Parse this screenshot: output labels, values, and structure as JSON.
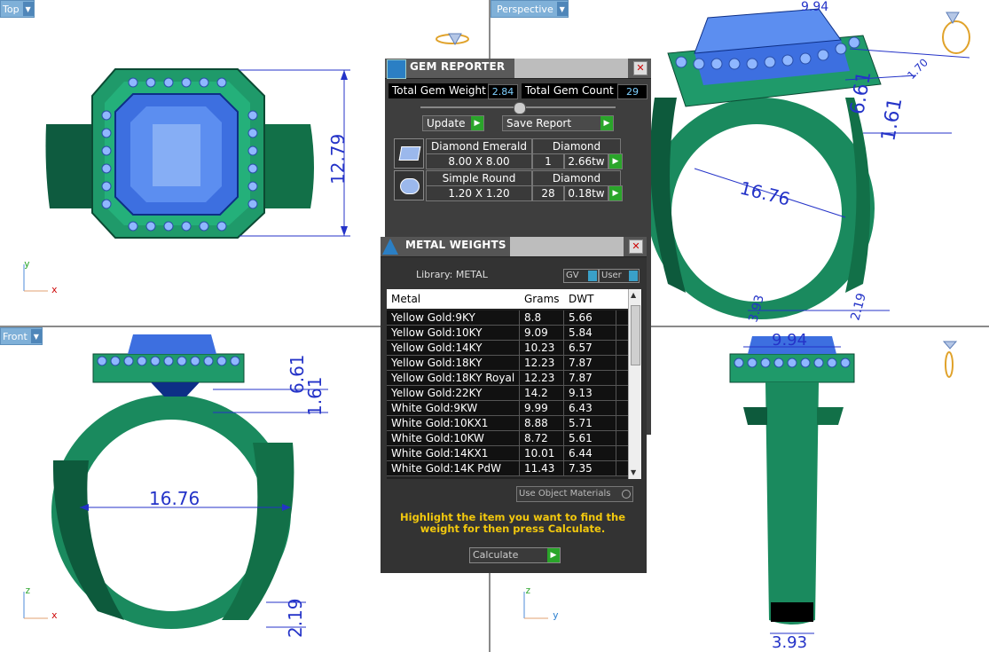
{
  "viewports": {
    "top": {
      "label": "Top",
      "dimension": "12.79",
      "axis_v": "y",
      "axis_h": "x"
    },
    "perspective": {
      "label": "Perspective",
      "dims": [
        "9.94",
        "6.61",
        "1.61",
        "16.76",
        "1.70",
        "3.93",
        "2.19"
      ]
    },
    "front": {
      "label": "Front",
      "dims": [
        "6.61",
        "1.61",
        "16.76",
        "2.19"
      ],
      "axis_v": "z",
      "axis_h": "x"
    },
    "right": {
      "dims": [
        "9.94",
        "3.93"
      ],
      "axis_v": "z",
      "axis_h": "y"
    }
  },
  "gem_reporter": {
    "title": "GEM REPORTER",
    "total_weight_label": "Total Gem Weight",
    "total_weight": "2.84",
    "total_count_label": "Total Gem Count",
    "total_count": "29",
    "update_label": "Update",
    "save_label": "Save Report",
    "gems": [
      {
        "name": "Diamond Emerald",
        "size": "8.00 X 8.00",
        "material": "Diamond",
        "count": "1",
        "weight": "2.66tw"
      },
      {
        "name": "Simple Round",
        "size": "1.20 X 1.20",
        "material": "Diamond",
        "count": "28",
        "weight": "0.18tw"
      }
    ]
  },
  "metal_weights": {
    "title": "METAL WEIGHTS",
    "library_label": "Library: METAL",
    "gv_label": "GV",
    "user_label": "User",
    "columns": [
      "Metal",
      "Grams",
      "DWT"
    ],
    "rows": [
      [
        "Yellow Gold:9KY",
        "8.8",
        "5.66"
      ],
      [
        "Yellow Gold:10KY",
        "9.09",
        "5.84"
      ],
      [
        "Yellow Gold:14KY",
        "10.23",
        "6.57"
      ],
      [
        "Yellow Gold:18KY",
        "12.23",
        "7.87"
      ],
      [
        "Yellow Gold:18KY Royal",
        "12.23",
        "7.87"
      ],
      [
        "Yellow Gold:22KY",
        "14.2",
        "9.13"
      ],
      [
        "White Gold:9KW",
        "9.99",
        "6.43"
      ],
      [
        "White Gold:10KX1",
        "8.88",
        "5.71"
      ],
      [
        "White Gold:10KW",
        "8.72",
        "5.61"
      ],
      [
        "White Gold:14KX1",
        "10.01",
        "6.44"
      ],
      [
        "White Gold:14K PdW",
        "11.43",
        "7.35"
      ]
    ],
    "use_object_materials": "Use Object Materials",
    "instruction": "Highlight the item you want to find the weight for then press Calculate.",
    "calculate_label": "Calculate"
  },
  "colors": {
    "metal": "#1f9a6a",
    "gem": "#3d6fe0",
    "dimension": "#2433c8",
    "accent_btn": "#2aa52a"
  }
}
